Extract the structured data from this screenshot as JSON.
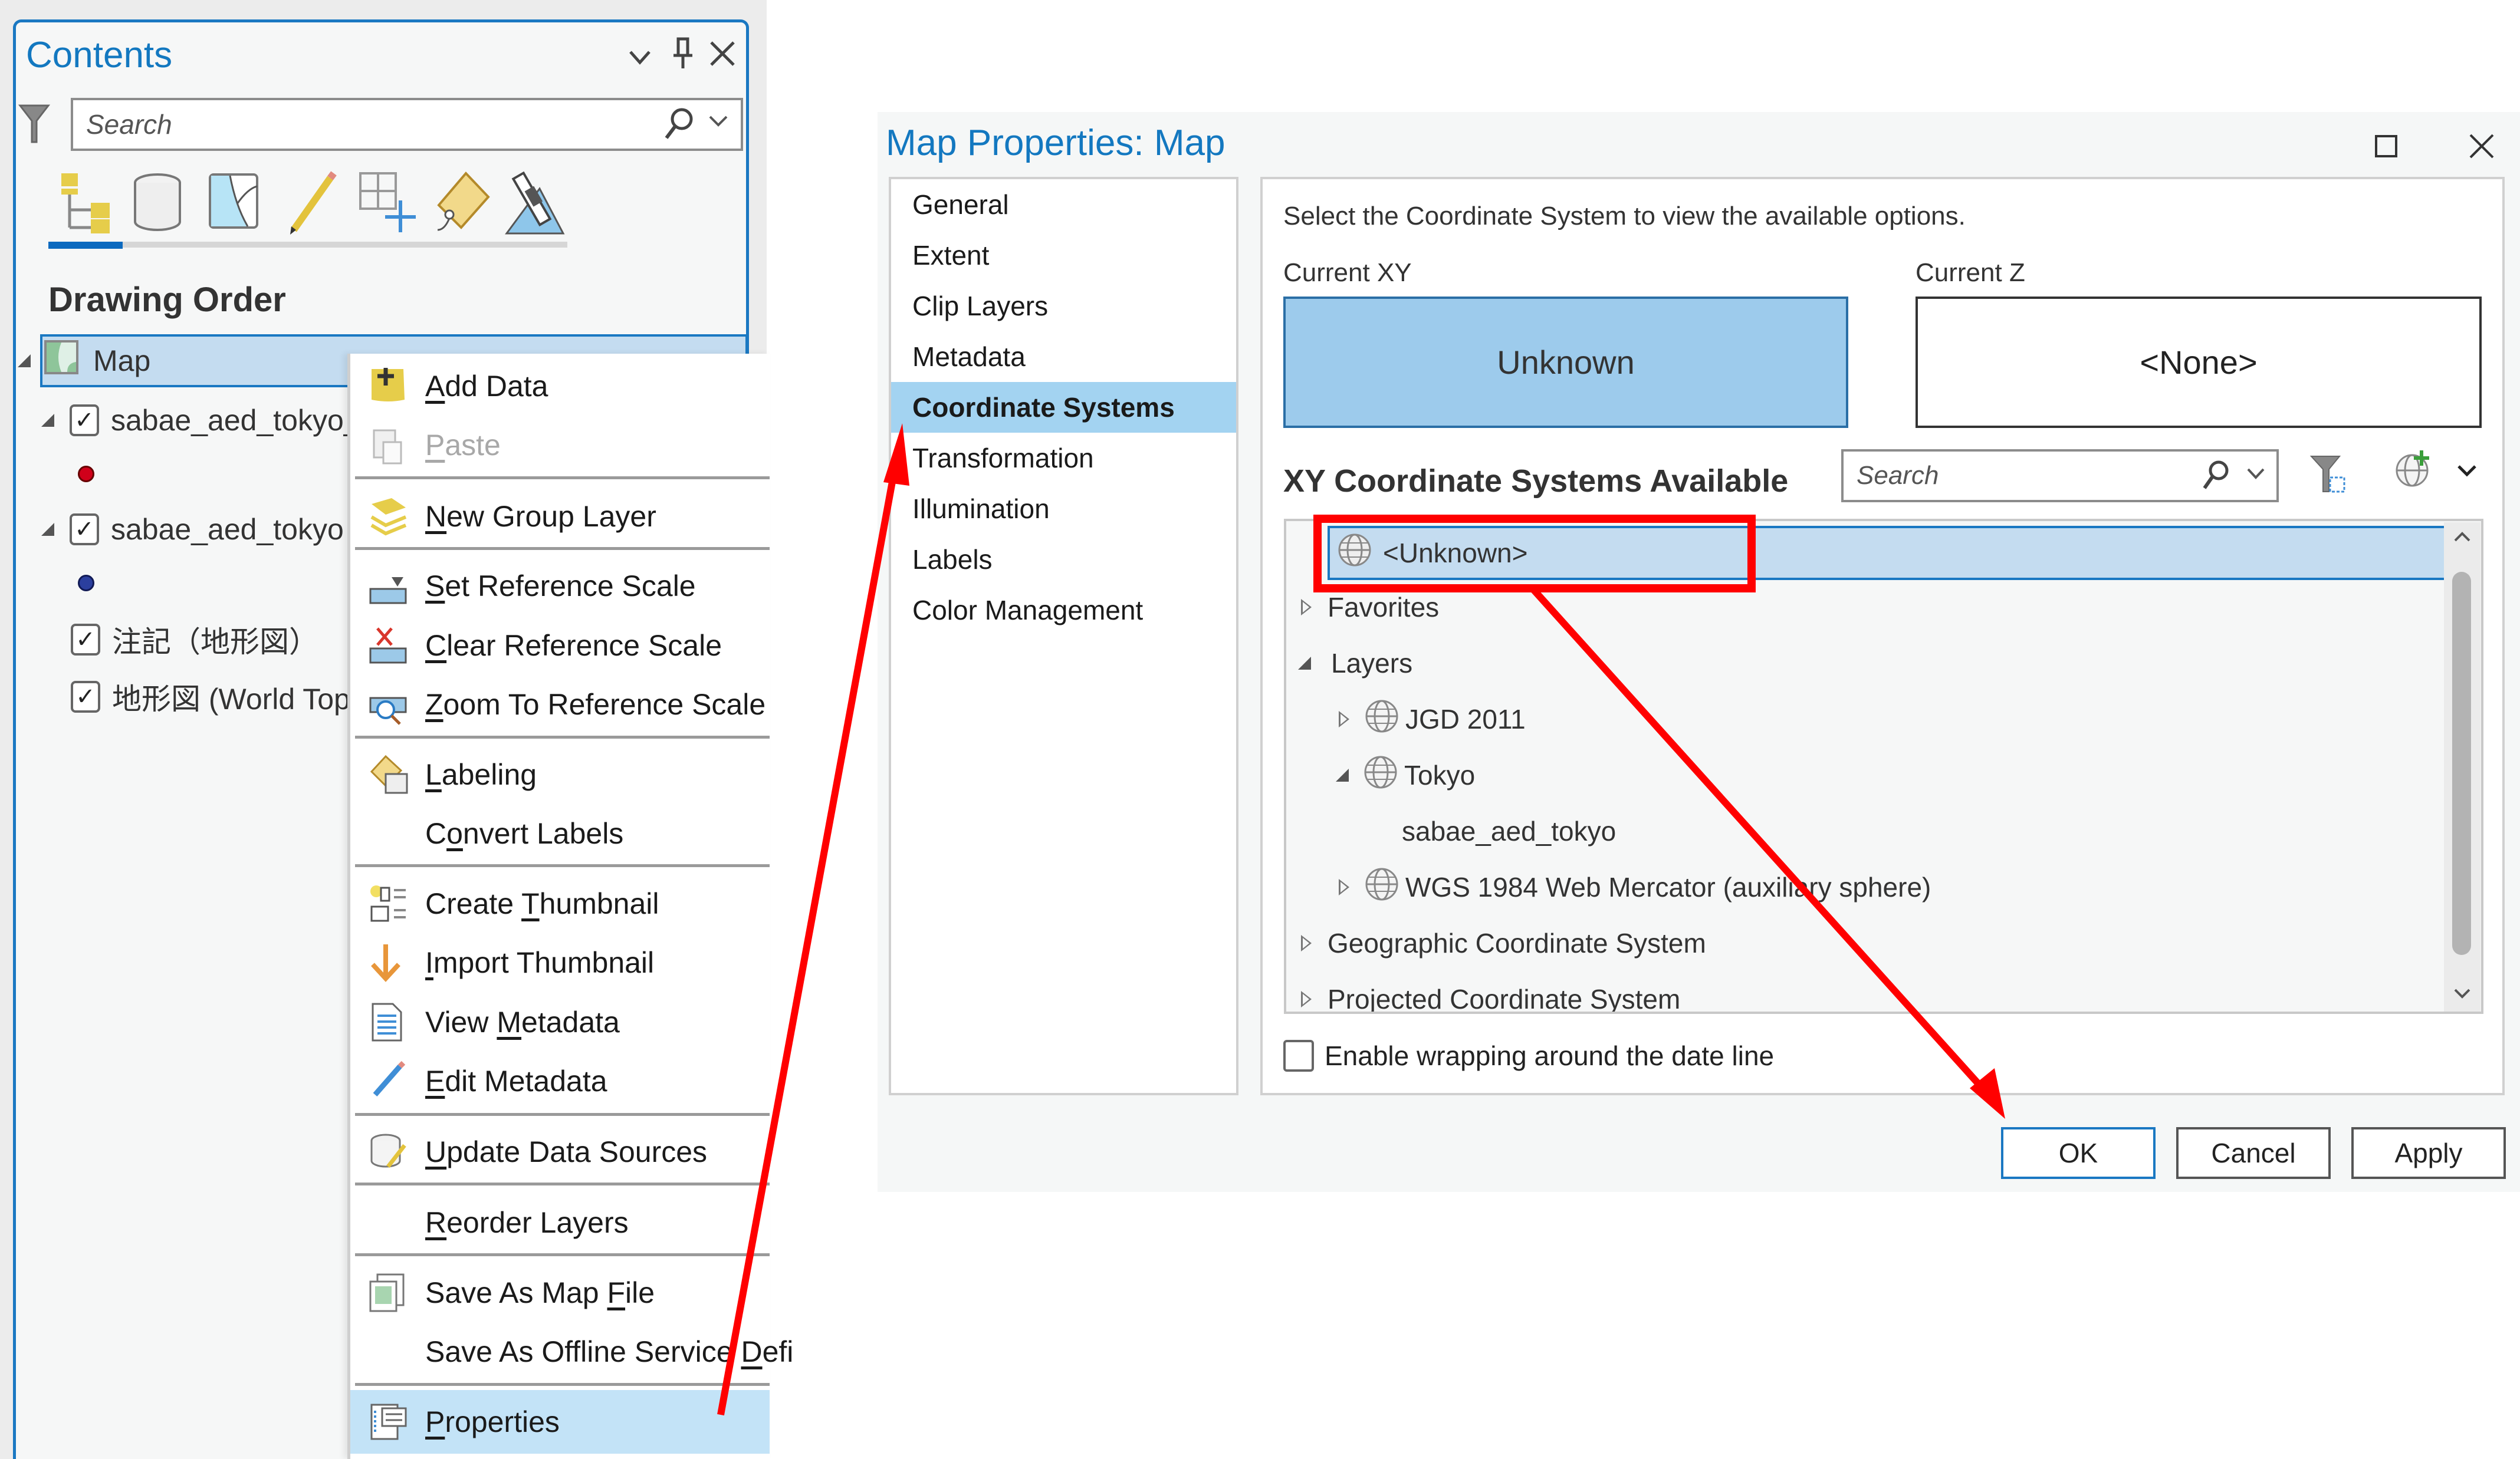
{
  "contents_pane": {
    "title": "Contents",
    "search_placeholder": "Search",
    "toolbar_icons": [
      "list-by-drawing-order-icon",
      "list-by-data-source-icon",
      "list-by-selection-icon",
      "list-by-editing-icon",
      "list-by-snapping-icon",
      "list-by-labeling-icon",
      "list-by-perspective-imagery-icon"
    ],
    "section_heading": "Drawing Order",
    "tree": [
      {
        "label": "Map",
        "level": 0,
        "expanded": true,
        "selected": true
      },
      {
        "label": "sabae_aed_tokyo_P",
        "level": 1,
        "checked": true,
        "expanded": true,
        "symbol_color": "#d0001a"
      },
      {
        "label": "sabae_aed_tokyo",
        "level": 1,
        "checked": true,
        "expanded": true,
        "symbol_color": "#2b3f9e"
      },
      {
        "label": "注記（地形図）",
        "level": 1,
        "checked": true
      },
      {
        "label": "地形図 (World Top",
        "level": 1,
        "checked": true
      }
    ]
  },
  "context_menu": {
    "items": [
      {
        "label": "Add Data",
        "accel": "A",
        "icon": "add-data-icon"
      },
      {
        "label": "Paste",
        "accel": "P",
        "icon": "paste-icon",
        "disabled": true
      },
      {
        "label": "New Group Layer",
        "accel": "N",
        "icon": "new-group-layer-icon"
      },
      {
        "label": "Set Reference Scale",
        "accel": "S",
        "icon": "set-reference-scale-icon"
      },
      {
        "label": "Clear Reference Scale",
        "accel": "C",
        "icon": "clear-reference-scale-icon"
      },
      {
        "label": "Zoom To Reference Scale",
        "accel": "Z",
        "icon": "zoom-to-reference-scale-icon"
      },
      {
        "label": "Labeling",
        "accel": "L",
        "icon": "labeling-icon"
      },
      {
        "label": "Convert Labels",
        "accel": "o",
        "icon": ""
      },
      {
        "label": "Create Thumbnail",
        "accel": "T",
        "icon": "create-thumbnail-icon"
      },
      {
        "label": "Import Thumbnail",
        "accel": "I",
        "icon": "import-thumbnail-icon"
      },
      {
        "label": "View Metadata",
        "accel": "M",
        "icon": "view-metadata-icon"
      },
      {
        "label": "Edit Metadata",
        "accel": "E",
        "icon": "edit-metadata-icon"
      },
      {
        "label": "Update Data Sources",
        "accel": "U",
        "icon": "update-data-sources-icon"
      },
      {
        "label": "Reorder Layers",
        "accel": "R",
        "icon": ""
      },
      {
        "label": "Save As Map File",
        "accel": "F",
        "icon": "save-as-map-file-icon"
      },
      {
        "label": "Save As Offline Service Defi",
        "accel": "D",
        "icon": ""
      },
      {
        "label": "Properties",
        "accel": "P",
        "icon": "properties-icon",
        "highlighted": true
      }
    ]
  },
  "dialog": {
    "title": "Map Properties: Map",
    "nav": [
      "General",
      "Extent",
      "Clip Layers",
      "Metadata",
      "Coordinate Systems",
      "Transformation",
      "Illumination",
      "Labels",
      "Color Management"
    ],
    "nav_selected": "Coordinate Systems",
    "instruction": "Select the Coordinate System to view the available options.",
    "current_xy_label": "Current XY",
    "current_xy_value": "Unknown",
    "current_z_label": "Current Z",
    "current_z_value": "<None>",
    "xy_available_heading": "XY Coordinate Systems Available",
    "search_placeholder": "Search",
    "cs_tree": [
      {
        "label": "<Unknown>",
        "level": 0,
        "icon": "globe-icon",
        "selected": true
      },
      {
        "label": "Favorites",
        "level": 0,
        "expander": "collapsed"
      },
      {
        "label": "Layers",
        "level": 0,
        "expander": "expanded"
      },
      {
        "label": "JGD 2011",
        "level": 1,
        "expander": "collapsed",
        "icon": "globe-icon"
      },
      {
        "label": "Tokyo",
        "level": 1,
        "expander": "expanded",
        "icon": "globe-icon"
      },
      {
        "label": "sabae_aed_tokyo",
        "level": 2
      },
      {
        "label": "WGS 1984 Web Mercator (auxiliary sphere)",
        "level": 1,
        "expander": "collapsed",
        "icon": "globe-icon"
      },
      {
        "label": "Geographic Coordinate System",
        "level": 0,
        "expander": "collapsed"
      },
      {
        "label": "Projected Coordinate System",
        "level": 0,
        "expander": "collapsed"
      }
    ],
    "wrap_checkbox_label": "Enable wrapping around the date line",
    "wrap_checked": false,
    "buttons": {
      "ok": "OK",
      "cancel": "Cancel",
      "apply": "Apply"
    }
  },
  "annotations": {
    "color": "#ff0000",
    "arrows": [
      "properties-to-coordinate-systems",
      "unknown-to-ok"
    ],
    "highlight_box": "unknown-cs-row"
  }
}
